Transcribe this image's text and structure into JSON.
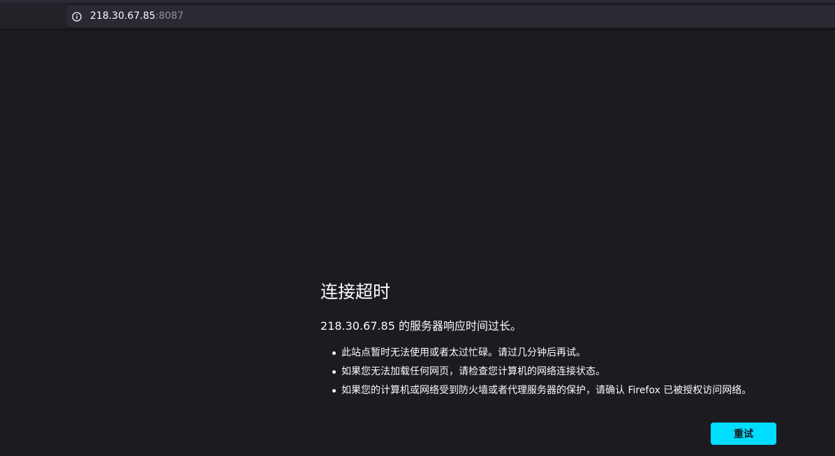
{
  "browser": {
    "address_bar": {
      "host": "218.30.67.85",
      "port": ":8087",
      "icon": "info-icon"
    }
  },
  "error_page": {
    "title": "连接超时",
    "description": "218.30.67.85 的服务器响应时间过长。",
    "suggestions": [
      "此站点暂时无法使用或者太过忙碌。请过几分钟后再试。",
      "如果您无法加载任何网页，请检查您计算机的网络连接状态。",
      "如果您的计算机或网络受到防火墙或者代理服务器的保护，请确认 Firefox 已被授权访问网络。"
    ],
    "retry_label": "重试"
  },
  "colors": {
    "background": "#1c1b22",
    "urlbar": "#2b2a33",
    "accent": "#00ddff",
    "text": "#fbfbfe"
  }
}
